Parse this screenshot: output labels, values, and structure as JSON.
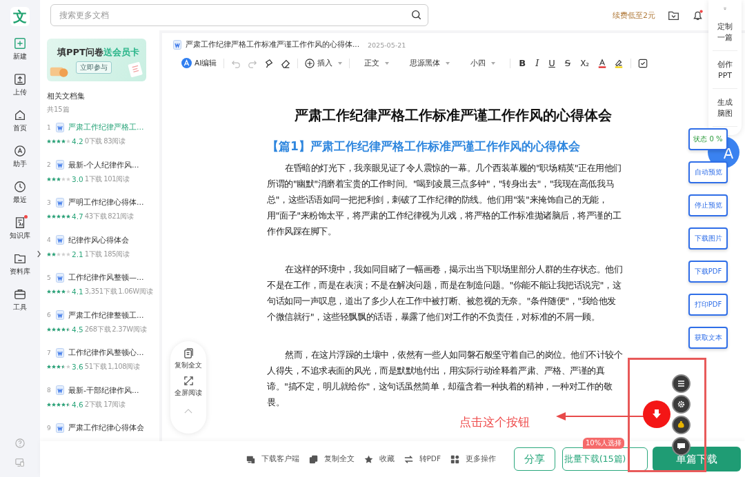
{
  "logo": "文",
  "nav": {
    "items": [
      {
        "label": "新建",
        "dot": false
      },
      {
        "label": "上传",
        "dot": false
      },
      {
        "label": "首页",
        "dot": false
      },
      {
        "label": "助手",
        "dot": false
      },
      {
        "label": "最近",
        "dot": false
      },
      {
        "label": "知识库",
        "dot": true
      },
      {
        "label": "资料库",
        "dot": false
      },
      {
        "label": "工具",
        "dot": false
      }
    ]
  },
  "search": {
    "placeholder": "搜索更多文档"
  },
  "header": {
    "promo": "续费低至2元",
    "notification_dot": true
  },
  "banner": {
    "title": "填PPT问卷",
    "highlight": "送会员卡",
    "button": "立即参与"
  },
  "collection": {
    "title": "相关文档集",
    "count": "共15篇",
    "items": [
      {
        "index": "1",
        "title": "严肃工作纪律严格工...",
        "selected": true,
        "stars": 4,
        "rating": "4.2",
        "downloads": "0下载",
        "reads": "83阅读"
      },
      {
        "index": "2",
        "title": "最新-个人纪律作风...",
        "selected": false,
        "stars": 3,
        "rating": "3.0",
        "downloads": "1下载",
        "reads": "101阅读"
      },
      {
        "index": "3",
        "title": "严明工作纪律心得体...",
        "selected": false,
        "stars": 5,
        "rating": "4.7",
        "downloads": "43下载",
        "reads": "821阅读"
      },
      {
        "index": "4",
        "title": "纪律作风心得体会",
        "selected": false,
        "stars": 2,
        "rating": "2.1",
        "downloads": "1下载",
        "reads": "185阅读"
      },
      {
        "index": "5",
        "title": "工作纪律作风整顿—...",
        "selected": false,
        "stars": 4,
        "rating": "4.1",
        "downloads": "3,351下载",
        "reads": "1.06W阅读"
      },
      {
        "index": "6",
        "title": "严肃工作纪律整顿工...",
        "selected": false,
        "stars": 4.5,
        "rating": "4.5",
        "downloads": "268下载",
        "reads": "2.37W阅读"
      },
      {
        "index": "7",
        "title": "工作纪律作风整顿心...",
        "selected": false,
        "stars": 3.5,
        "rating": "3.6",
        "downloads": "51下载",
        "reads": "1,108阅读"
      },
      {
        "index": "8",
        "title": "最新-干部纪律作风...",
        "selected": false,
        "stars": 4.5,
        "rating": "4.6",
        "downloads": "2下载",
        "reads": "17阅读"
      },
      {
        "index": "9",
        "title": "严肃工作纪律心得体会",
        "selected": false
      }
    ]
  },
  "document": {
    "file_title": "严肃工作纪律严格工作标准严谨工作作风的心得体...",
    "date": "2025-05-21",
    "toolbar": {
      "ai_button": "AI编辑",
      "history": [
        {
          "kind": "undo",
          "disabled": true
        },
        {
          "kind": "redo",
          "disabled": true
        }
      ],
      "insert": "插入",
      "style": "正文",
      "font": "思源黑体",
      "size": "小四",
      "format": [
        {
          "glyph": "B",
          "kind": "bold"
        },
        {
          "glyph": "I",
          "kind": "italic"
        },
        {
          "glyph": "U",
          "kind": "underline"
        },
        {
          "glyph": "S",
          "kind": "strike"
        },
        {
          "glyph": "X₂",
          "kind": "subscript"
        }
      ]
    },
    "heading": "严肃工作纪律严格工作标准严谨工作作风的心得体会",
    "section_title": "【篇1】严肃工作纪律严格工作标准严谨工作作风的心得体会",
    "paragraphs": [
      "在昏暗的灯光下，我亲眼见证了令人震惊的一幕。几个西装革履的\"职场精英\"正在用他们所谓的\"幽默\"消磨着宝贵的工作时间。\"喝到凌晨三点多钟\"，\"转身出去\"，\"我现在高低我马总\"，这些话语如同一把把利剑，刺破了工作纪律的防线。他们用\"装\"来掩饰自己的无能，用\"面子\"来粉饰太平，将严肃的工作纪律视为儿戏，将严格的工作标准抛诸脑后，将严谨的工作作风踩在脚下。",
      "在这样的环境中，我如同目睹了一幅画卷，揭示出当下职场里部分人群的生存状态。他们不是在工作，而是在表演；不是在解决问题，而是在制造问题。\"你能不能让我把话说完\"，这句话如同一声叹息，道出了多少人在工作中被打断、被忽视的无奈。\"条件随便\"，\"我给他发个微信就行\"，这些轻飘飘的话语，暴露了他们对工作的不负责任，对标准的不屑一顾。",
      "然而，在这片浮躁的土壤中，依然有一些人如同磐石般坚守着自己的岗位。他们不计较个人得失，不追求表面的风光，而是默默地付出，用实际行动诠释着严肃、严格、严谨的真谛。\"搞不定，明儿就给你\"，这句话虽然简单，却蕴含着一种执着的精神，一种对工作的敬畏。"
    ]
  },
  "reader_tools": [
    "复制全文",
    "全屏阅读"
  ],
  "side_panel": {
    "items": [
      "定制一篇",
      "创作PPT",
      "生成脑图"
    ]
  },
  "float_buttons": [
    {
      "label": "状态 0 %",
      "kind": "status"
    },
    {
      "label": "自动预览",
      "kind": "action"
    },
    {
      "label": "停止预览",
      "kind": "action"
    },
    {
      "label": "下载图片",
      "kind": "action"
    },
    {
      "label": "下载PDF",
      "kind": "action"
    },
    {
      "label": "打印PDF",
      "kind": "action"
    },
    {
      "label": "获取文本",
      "kind": "action"
    }
  ],
  "annotation": {
    "text": "点击这个按钮"
  },
  "bottom_bar": {
    "actions": [
      "下载客户端",
      "复制全文",
      "收藏",
      "转PDF",
      "更多操作"
    ],
    "share": "分享",
    "batch": "批量下载(15篇)",
    "batch_badge": "10%人选择",
    "single": "单篇下载"
  }
}
